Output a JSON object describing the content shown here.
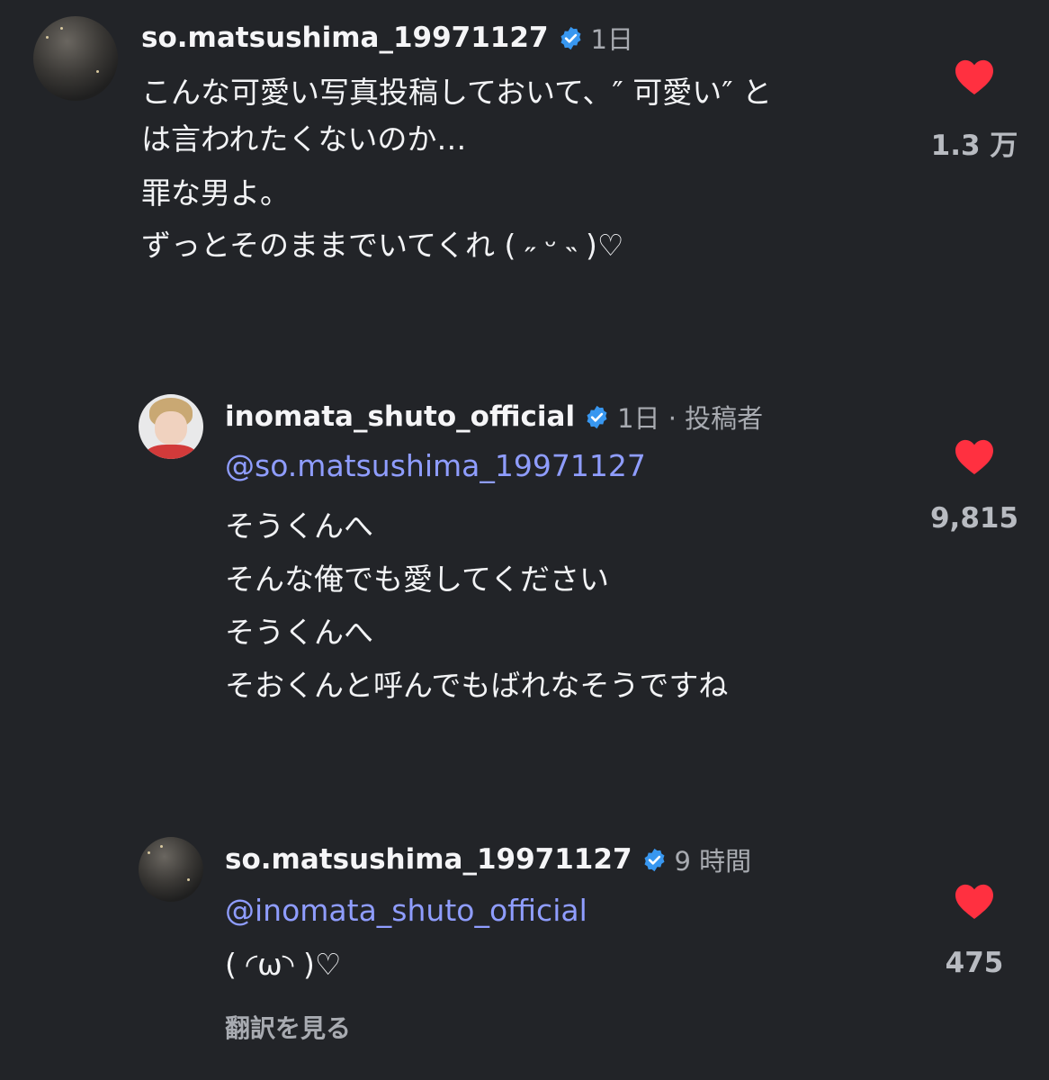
{
  "comments": [
    {
      "username": "so.matsushima_19971127",
      "time": "1日",
      "lines": [
        "こんな可愛い写真投稿しておいて、″ 可愛い″ と",
        "は言われたくないのか…",
        "罪な男よ。",
        "ずっとそのままでいてくれ ( ˶ ᵕ ˵ )♡"
      ],
      "likes": "1.3 万"
    },
    {
      "username": "inomata_shuto_official",
      "time": "1日 · 投稿者",
      "mention": "@so.matsushima_19971127",
      "lines": [
        "そうくんへ",
        "そんな俺でも愛してください",
        "そうくんへ",
        "そおくんと呼んでもばれなそうですね"
      ],
      "likes": "9,815"
    },
    {
      "username": "so.matsushima_19971127",
      "time": "9 時間",
      "mention": "@inomata_shuto_official",
      "lines": [
        "( ◜ω◝ )♡"
      ],
      "translate": "翻訳を見る",
      "likes": "475"
    }
  ],
  "colors": {
    "background": "#222428",
    "heart": "#ff3040",
    "verified": "#3897f0",
    "mention": "#8f9dff"
  }
}
